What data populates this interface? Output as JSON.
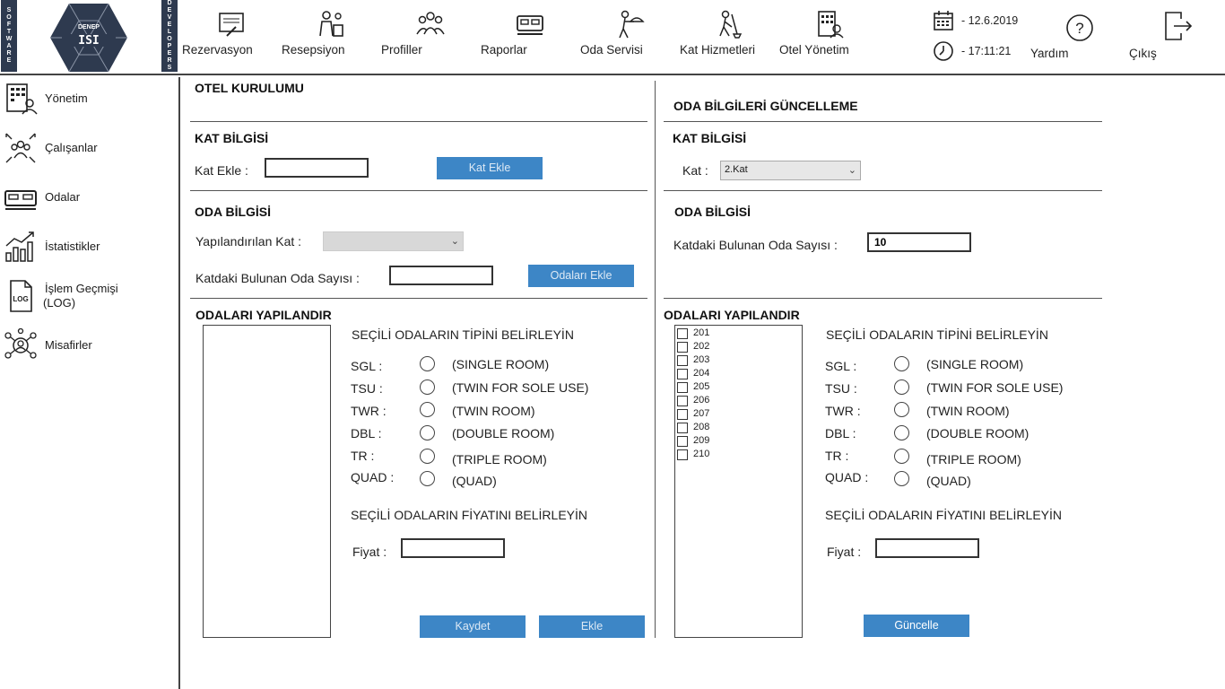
{
  "logo": {
    "left_strip": [
      "S",
      "O",
      "F",
      "T",
      "W",
      "A",
      "R",
      "E"
    ],
    "right_strip": [
      "D",
      "E",
      "V",
      "E",
      "L",
      "O",
      "P",
      "E",
      "R",
      "S"
    ],
    "caption": "DENEP",
    "mark": "ISI"
  },
  "nav": [
    {
      "label": "Rezervasyon",
      "icon": "reservation-icon"
    },
    {
      "label": "Resepsiyon",
      "icon": "reception-icon"
    },
    {
      "label": "Profiller",
      "icon": "profiles-icon"
    },
    {
      "label": "Raporlar",
      "icon": "reports-icon"
    },
    {
      "label": "Oda Servisi",
      "icon": "room-service-icon"
    },
    {
      "label": "Kat Hizmetleri",
      "icon": "housekeeping-icon"
    },
    {
      "label": "Otel Yönetim",
      "icon": "hotel-management-icon"
    }
  ],
  "datetime": {
    "date": "- 12.6.2019",
    "time": "- 17:11:21"
  },
  "help": {
    "label": "Yardım"
  },
  "exit": {
    "label": "Çıkış"
  },
  "sidebar": [
    {
      "label": "Yönetim",
      "icon": "management-icon"
    },
    {
      "label": "Çalışanlar",
      "icon": "employees-icon"
    },
    {
      "label": "Odalar",
      "icon": "rooms-icon"
    },
    {
      "label": "İstatistikler",
      "icon": "statistics-icon"
    },
    {
      "label": "İşlem Geçmişi (LOG)",
      "label1": "İşlem Geçmişi",
      "label2": "(LOG)",
      "icon": "log-icon"
    },
    {
      "label": "Misafirler",
      "icon": "guests-icon"
    }
  ],
  "left": {
    "title": "OTEL KURULUMU",
    "kat_bilgisi": "KAT BİLGİSİ",
    "kat_ekle_label": "Kat Ekle :",
    "kat_ekle_value": "",
    "kat_ekle_button": "Kat Ekle",
    "oda_bilgisi": "ODA BİLGİSİ",
    "yapilandirilan_label": "Yapılandırılan Kat :",
    "yapilandirilan_value": "",
    "oda_sayisi_label": "Katdaki Bulunan Oda Sayısı :",
    "oda_sayisi_value": "",
    "odalari_ekle_button": "Odaları Ekle",
    "configure_title": "ODALARI YAPILANDIR",
    "type_title": "SEÇİLİ ODALARIN TİPİNİ BELİRLEYİN",
    "price_title": "SEÇİLİ ODALARIN FİYATINI BELİRLEYİN",
    "price_label": "Fiyat :",
    "price_value": "",
    "save_button": "Kaydet",
    "add_button": "Ekle"
  },
  "right": {
    "title": "ODA BİLGİLERİ GÜNCELLEME",
    "kat_bilgisi": "KAT BİLGİSİ",
    "kat_label": "Kat :",
    "kat_value": "2.Kat",
    "oda_bilgisi": "ODA BİLGİSİ",
    "oda_sayisi_label": "Katdaki Bulunan Oda Sayısı :",
    "oda_sayisi_value": "10",
    "configure_title": "ODALARI YAPILANDIR",
    "rooms": [
      "201",
      "202",
      "203",
      "204",
      "205",
      "206",
      "207",
      "208",
      "209",
      "210"
    ],
    "type_title": "SEÇİLİ ODALARIN TİPİNİ BELİRLEYİN",
    "price_title": "SEÇİLİ ODALARIN FİYATINI BELİRLEYİN",
    "price_label": "Fiyat :",
    "price_value": "",
    "update_button": "Güncelle"
  },
  "room_types": [
    {
      "code": "SGL :",
      "desc": "(SINGLE ROOM)"
    },
    {
      "code": "TSU :",
      "desc": "(TWIN FOR SOLE USE)"
    },
    {
      "code": "TWR :",
      "desc": "(TWIN ROOM)"
    },
    {
      "code": "DBL :",
      "desc": "(DOUBLE ROOM)"
    },
    {
      "code": "TR :",
      "desc": "(TRIPLE ROOM)"
    },
    {
      "code": "QUAD :",
      "desc": "(QUAD)"
    }
  ],
  "colors": {
    "button": "#3d86c6",
    "logo_dark": "#2e3a4f",
    "border": "#444444"
  }
}
